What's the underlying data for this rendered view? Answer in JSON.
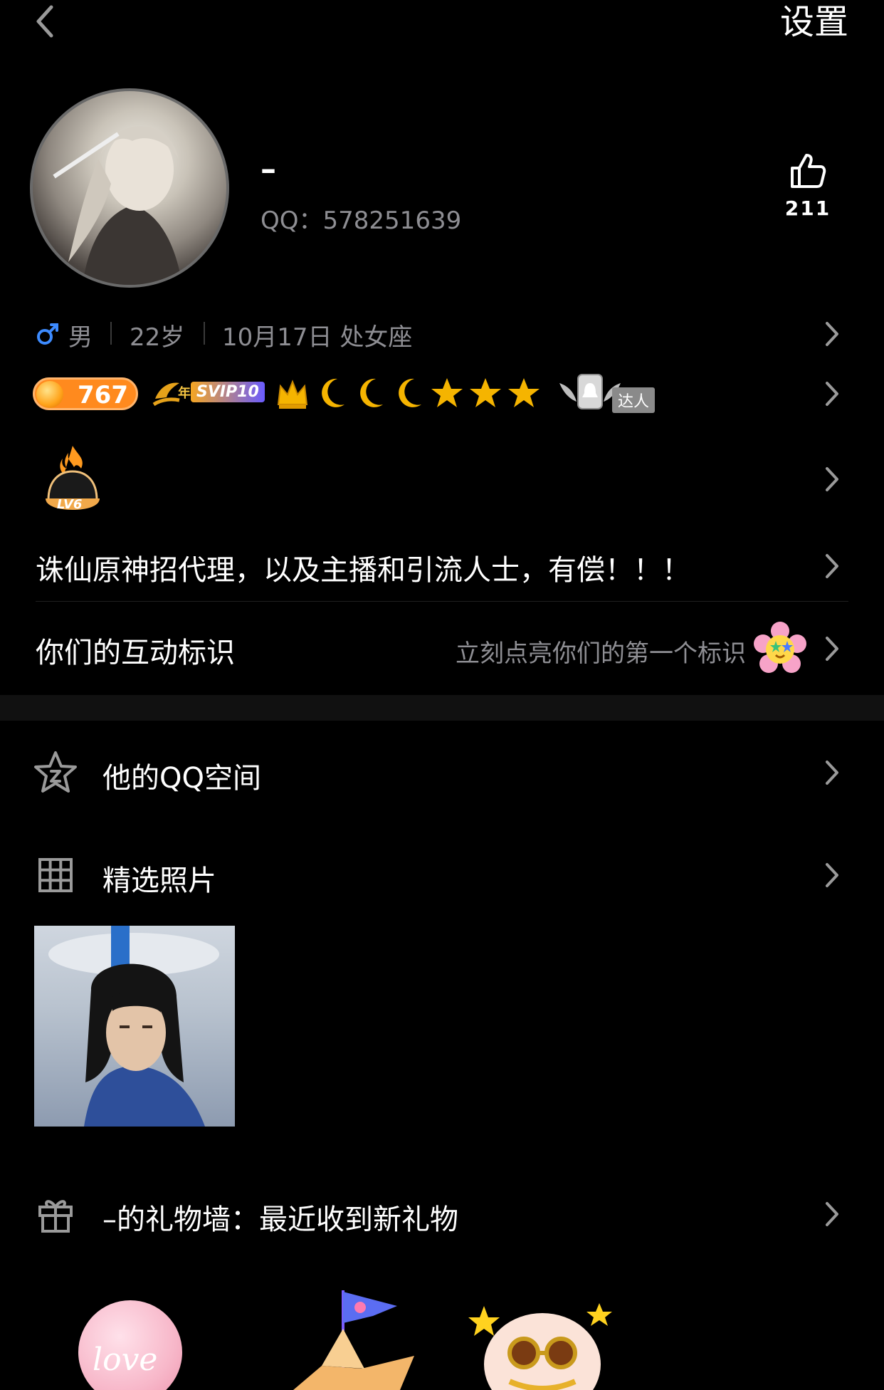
{
  "header": {
    "settings_label": "设置"
  },
  "profile": {
    "nickname": "–",
    "qq": "QQ：578251639",
    "likes": "211"
  },
  "info": {
    "gender": "男",
    "age": "22岁",
    "birthday": "10月17日 处女座"
  },
  "badges": {
    "coin_value": "767",
    "svip_label": "SVIP10",
    "svip_year": "年",
    "daren_label": "达人",
    "level_label": "LV6"
  },
  "signature": "诛仙原神招代理，以及主播和引流人士，有偿！！！",
  "interaction": {
    "title": "你们的互动标识",
    "hint": "立刻点亮你们的第一个标识"
  },
  "menu": {
    "qzone": "他的QQ空间",
    "photos": "精选照片",
    "gift_wall": "–的礼物墙：最近收到新礼物"
  },
  "gifts": [
    {
      "text": "love"
    }
  ],
  "colors": {
    "background": "#000000",
    "muted_text": "#8e8e93",
    "male_blue": "#3d8bff",
    "coin_orange": "#ff8a1e",
    "gold": "#f5b400"
  }
}
